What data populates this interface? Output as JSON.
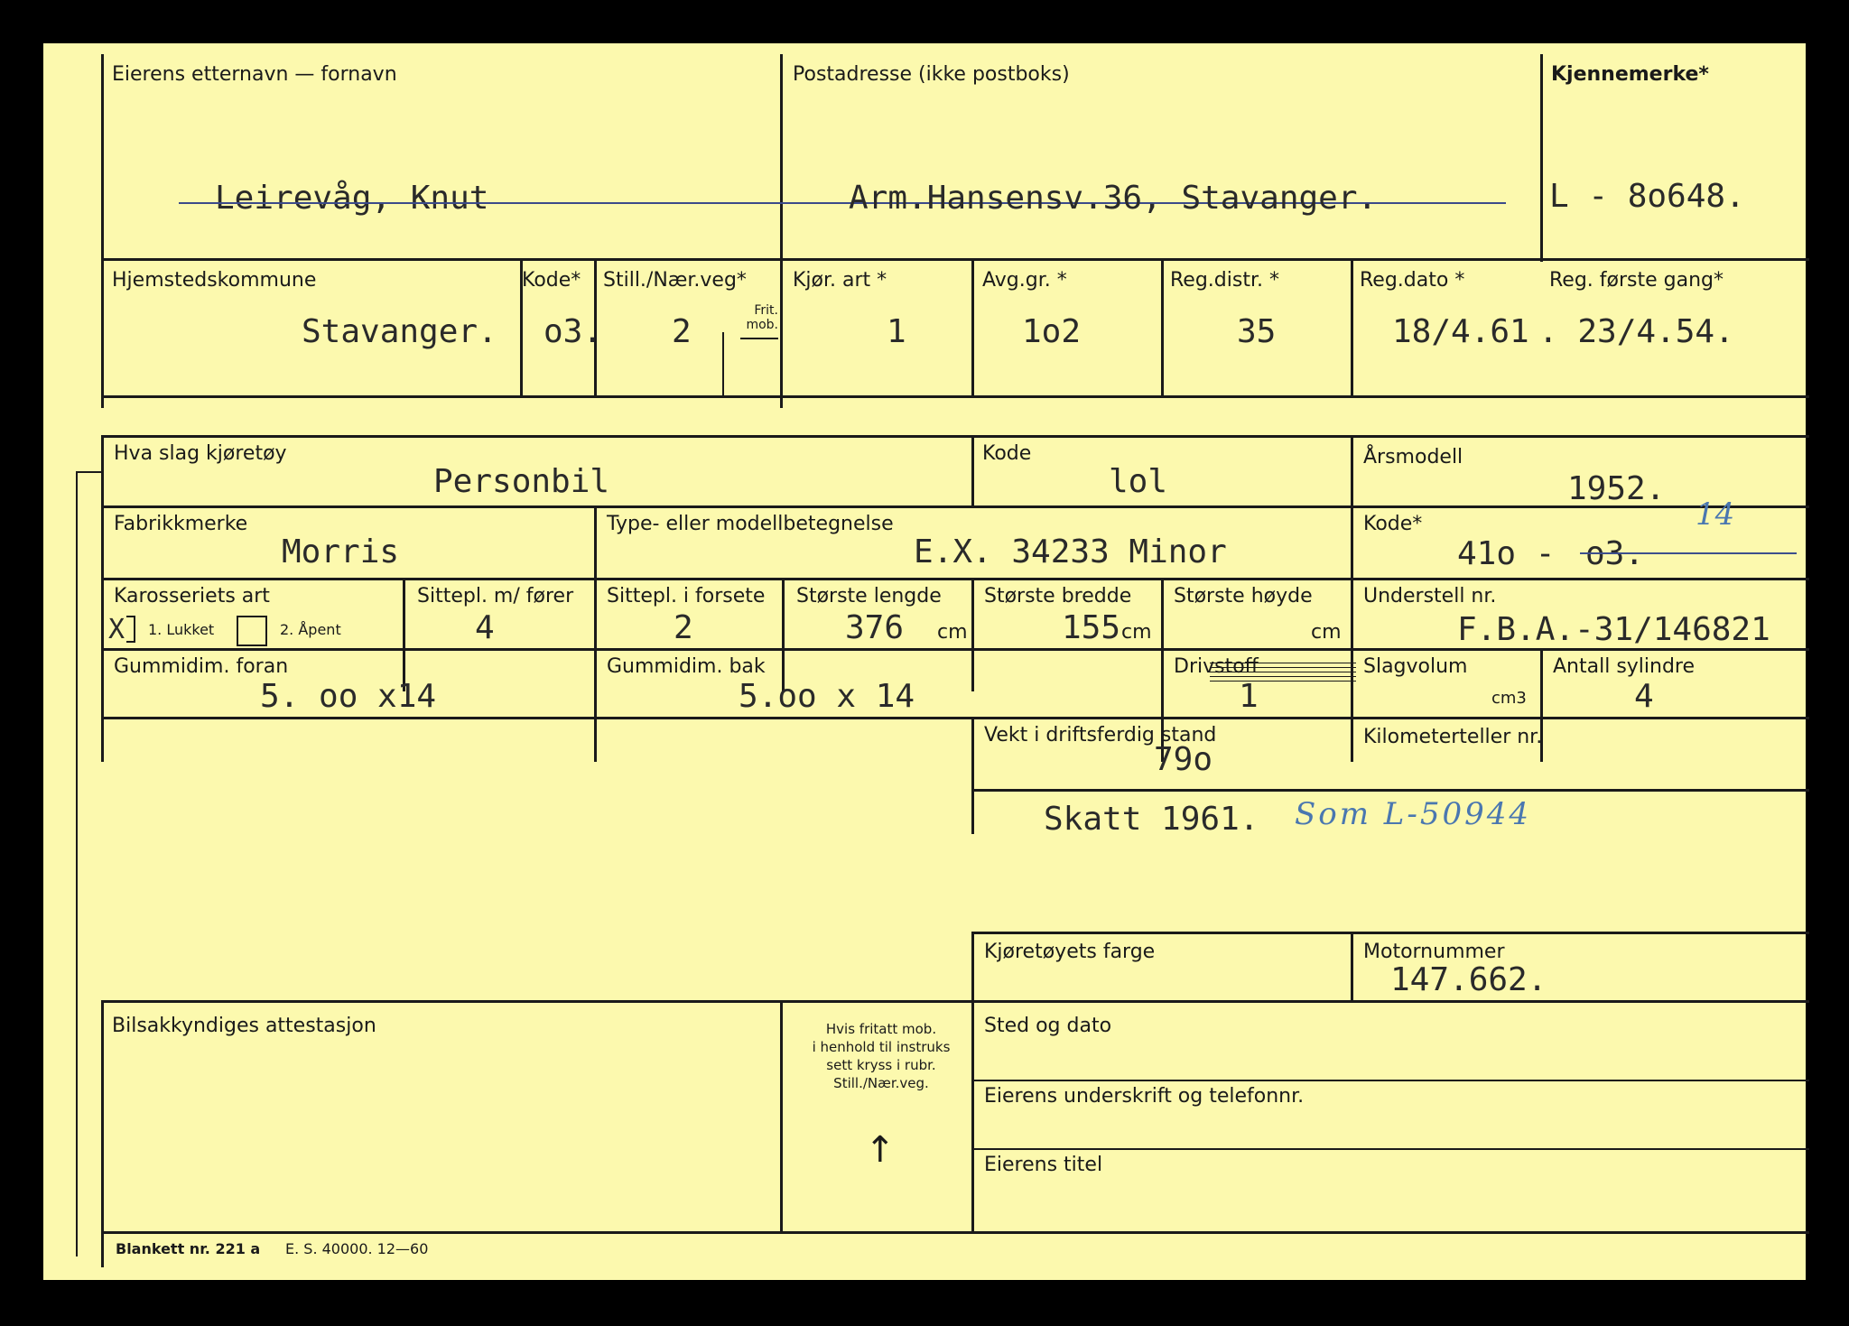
{
  "owner": {
    "label": "Eierens etternavn — fornavn",
    "value": "Leirevåg, Knut"
  },
  "address": {
    "label": "Postadresse (ikke postboks)",
    "value": "Arm.Hansensv.36, Stavanger."
  },
  "reg_mark": {
    "label": "Kjennemerke*",
    "value": "L - 8o648."
  },
  "row2": {
    "municipality": {
      "label": "Hjemstedskommune",
      "value": "Stavanger."
    },
    "code": {
      "label": "Kode*",
      "value": "o3."
    },
    "position": {
      "label": "Still./Nær.veg*",
      "value": "2",
      "sub": "Frit. mob."
    },
    "drive_type": {
      "label": "Kjør. art *",
      "value": "1"
    },
    "tax_group": {
      "label": "Avg.gr. *",
      "value": "1o2"
    },
    "reg_district": {
      "label": "Reg.distr. *",
      "value": "35"
    },
    "reg_date": {
      "label": "Reg.dato *",
      "value": "18/4.61"
    },
    "first_reg": {
      "label": "Reg. første gang*",
      "value": ". 23/4.54."
    }
  },
  "vehicle": {
    "kind": {
      "label": "Hva slag kjøretøy",
      "value": "Personbil"
    },
    "kind_code": {
      "label": "Kode",
      "value": "lol"
    },
    "model_year": {
      "label": "Årsmodell",
      "value": "1952."
    },
    "make": {
      "label": "Fabrikkmerke",
      "value": "Morris"
    },
    "model": {
      "label": "Type- eller modellbetegnelse",
      "value": "E.X. 34233  Minor"
    },
    "make_code": {
      "label": "Kode*",
      "value": "41o -",
      "struck": "o3.",
      "handwritten": "14"
    },
    "body": {
      "label": "Karosseriets art",
      "opt1": "1. Lukket",
      "opt2": "2. Åpent",
      "mark": "X"
    },
    "seats_driver": {
      "label": "Sittepl. m/ fører",
      "value": "4"
    },
    "seats_front": {
      "label": "Sittepl. i forsete",
      "value": "2"
    },
    "length": {
      "label": "Største lengde",
      "value": "376",
      "unit": "cm"
    },
    "width": {
      "label": "Største bredde",
      "value": "155",
      "unit": "cm"
    },
    "height": {
      "label": "Største høyde",
      "unit": "cm"
    },
    "chassis": {
      "label": "Understell nr.",
      "value": "F.B.A.-31/146821"
    },
    "tyres_front": {
      "label": "Gummidim. foran",
      "value": "5. oo x14"
    },
    "tyres_rear": {
      "label": "Gummidim. bak",
      "value": "5.oo x 14"
    },
    "fuel": {
      "label": "Drivstoff",
      "value": "1"
    },
    "displacement": {
      "label": "Slagvolum",
      "unit": "cm3"
    },
    "cylinders": {
      "label": "Antall sylindre",
      "value": "4"
    },
    "weight": {
      "label": "Vekt i driftsferdig stand",
      "value": "79o"
    },
    "odometer": {
      "label": "Kilometerteller nr."
    }
  },
  "tax_note": "Skatt 1961.",
  "hand_note": "Som L-50944",
  "colour": {
    "label": "Kjøretøyets farge"
  },
  "engine_no": {
    "label": "Motornummer",
    "value": "147.662."
  },
  "attest": {
    "label": "Bilsakkyndiges attestasjon",
    "note": [
      "Hvis fritatt mob.",
      "i henhold til instruks",
      "sett kryss i rubr.",
      "Still./Nær.veg."
    ],
    "arrow": "↑"
  },
  "place_date": {
    "label": "Sted og dato"
  },
  "signature": {
    "label": "Eierens underskrift og telefonnr."
  },
  "owner_title": {
    "label": "Eierens titel"
  },
  "footer": {
    "form": "Blankett nr. 221 a",
    "print": "E. S. 40000. 12—60"
  }
}
